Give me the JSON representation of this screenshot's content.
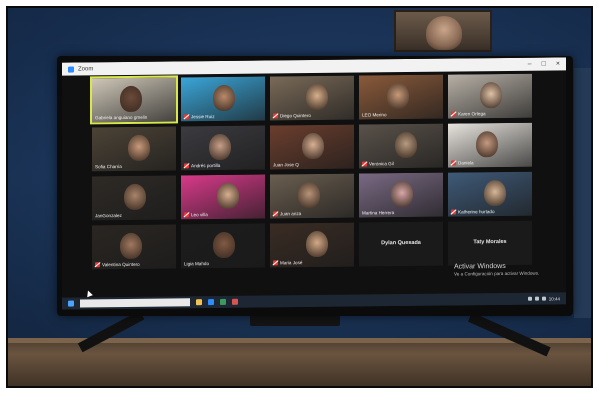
{
  "window": {
    "title": "Zoom"
  },
  "participants": [
    {
      "id": "p1",
      "name": "Gabriela anguiano gmelin",
      "muted": false,
      "active": true,
      "has_video": true,
      "bg": "#cfc7b8",
      "face": "#6b4a3a"
    },
    {
      "id": "p2",
      "name": "Jessie Ruiz",
      "muted": true,
      "has_video": true,
      "bg": "#3aa6d9",
      "face": "#b98a6a"
    },
    {
      "id": "p3",
      "name": "Diego Quintero",
      "muted": true,
      "has_video": true,
      "bg": "#7a6a58",
      "face": "#d8b08c"
    },
    {
      "id": "p4",
      "name": "LEO Merino",
      "muted": false,
      "has_video": true,
      "bg": "#8a5a3a",
      "face": "#c89a78"
    },
    {
      "id": "p5",
      "name": "Karen Ortega",
      "muted": true,
      "has_video": true,
      "bg": "#b7b0a6",
      "face": "#e0c2a6"
    },
    {
      "id": "p6",
      "name": "Sofia Charria",
      "muted": false,
      "has_video": true,
      "bg": "#4c4336",
      "face": "#c99b7b"
    },
    {
      "id": "p7",
      "name": "Andrés portilla",
      "muted": true,
      "has_video": true,
      "bg": "#3b3b40",
      "face": "#c7a088"
    },
    {
      "id": "p8",
      "name": "Juan Jose Q",
      "muted": false,
      "has_video": true,
      "bg": "#6b3e2e",
      "face": "#d9b094"
    },
    {
      "id": "p9",
      "name": "Verónica Gil",
      "muted": true,
      "has_video": true,
      "bg": "#5a524a",
      "face": "#b89b80"
    },
    {
      "id": "p10",
      "name": "Daniela",
      "muted": true,
      "has_video": true,
      "bg": "#e8e4de",
      "face": "#c59a80"
    },
    {
      "id": "p11",
      "name": "JanGonzalez",
      "muted": false,
      "has_video": true,
      "bg": "#2e2a26",
      "face": "#a8846a"
    },
    {
      "id": "p12",
      "name": "Leo villa",
      "muted": true,
      "has_video": true,
      "bg": "#d83a8a",
      "face": "#d8b090"
    },
    {
      "id": "p13",
      "name": "Juan ariza",
      "muted": true,
      "has_video": true,
      "bg": "#6a5e50",
      "face": "#b89478"
    },
    {
      "id": "p14",
      "name": "Martina Herrera",
      "muted": false,
      "has_video": true,
      "bg": "#7a6a84",
      "face": "#d8a8a8"
    },
    {
      "id": "p15",
      "name": "Katherine hurtado",
      "muted": true,
      "has_video": true,
      "bg": "#3f5a78",
      "face": "#d8b898"
    },
    {
      "id": "p16",
      "name": "Valentina Quintero",
      "muted": true,
      "has_video": true,
      "bg": "#2a2622",
      "face": "#a07860"
    },
    {
      "id": "p17",
      "name": "Ligia Mahdo",
      "muted": false,
      "has_video": true,
      "bg": "#1c1c1c",
      "face": "#805a44"
    },
    {
      "id": "p18",
      "name": "Maria José",
      "muted": true,
      "has_video": true,
      "bg": "#3a2c24",
      "face": "#d4aa88"
    },
    {
      "id": "p19",
      "name": "Dylan Quesada",
      "muted": false,
      "has_video": false
    },
    {
      "id": "p20",
      "name": "Taty Morales",
      "muted": false,
      "has_video": false
    }
  ],
  "watermark": {
    "title": "Activar Windows",
    "subtitle": "Ve a Configuración para activar Windows."
  },
  "taskbar": {
    "clock": "10:44"
  }
}
